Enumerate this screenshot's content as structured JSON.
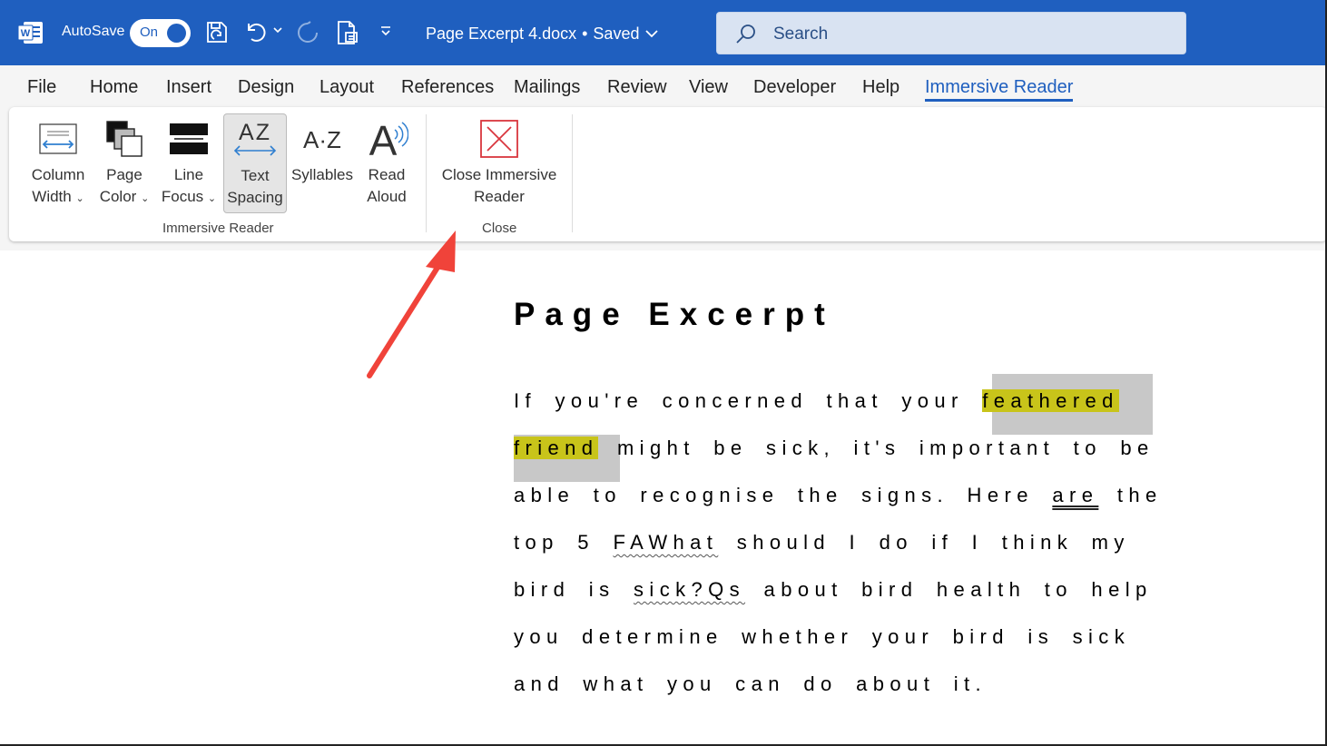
{
  "titlebar": {
    "autosave_label": "AutoSave",
    "toggle_state": "On",
    "doc_title": "Page Excerpt 4.docx",
    "saved_sep": "•",
    "saved_status": "Saved",
    "search_placeholder": "Search"
  },
  "menu": {
    "items": [
      "File",
      "Home",
      "Insert",
      "Design",
      "Layout",
      "References",
      "Mailings",
      "Review",
      "View",
      "Developer",
      "Help",
      "Immersive Reader"
    ],
    "active": "Immersive Reader"
  },
  "ribbon": {
    "buttons": [
      {
        "line1": "Column",
        "line2": "Width",
        "dropdown": true
      },
      {
        "line1": "Page",
        "line2": "Color",
        "dropdown": true
      },
      {
        "line1": "Line",
        "line2": "Focus",
        "dropdown": true
      },
      {
        "line1": "Text",
        "line2": "Spacing",
        "selected": true
      },
      {
        "line1": "Syllables",
        "line2": ""
      },
      {
        "line1": "Read",
        "line2": "Aloud"
      },
      {
        "line1": "Close Immersive",
        "line2": "Reader"
      }
    ],
    "groups": [
      "Immersive Reader",
      "Close"
    ]
  },
  "document": {
    "heading": "Page Excerpt",
    "lines": [
      {
        "pre": "If you're concerned that your ",
        "hl": "feathered",
        "post": ""
      },
      {
        "hl": "friend",
        "post": " might be sick, it's important to be"
      },
      {
        "pre": "able to recognise the signs. Here ",
        "underline": "are",
        "post": " the"
      },
      {
        "pre": "top 5 ",
        "wavy": "FAWhat",
        "post": " should I do if I think my"
      },
      {
        "pre": "bird is ",
        "wavy": "sick?Qs",
        "post": " about bird health to help"
      },
      {
        "pre": "you determine whether your bird is sick"
      },
      {
        "pre": "and what you can do about it."
      }
    ]
  },
  "colors": {
    "brand_blue": "#1f5fbf",
    "highlight_yellow": "#c8c41a",
    "highlight_gray": "#c8c8c8",
    "annotation_arrow": "#f0433a"
  }
}
